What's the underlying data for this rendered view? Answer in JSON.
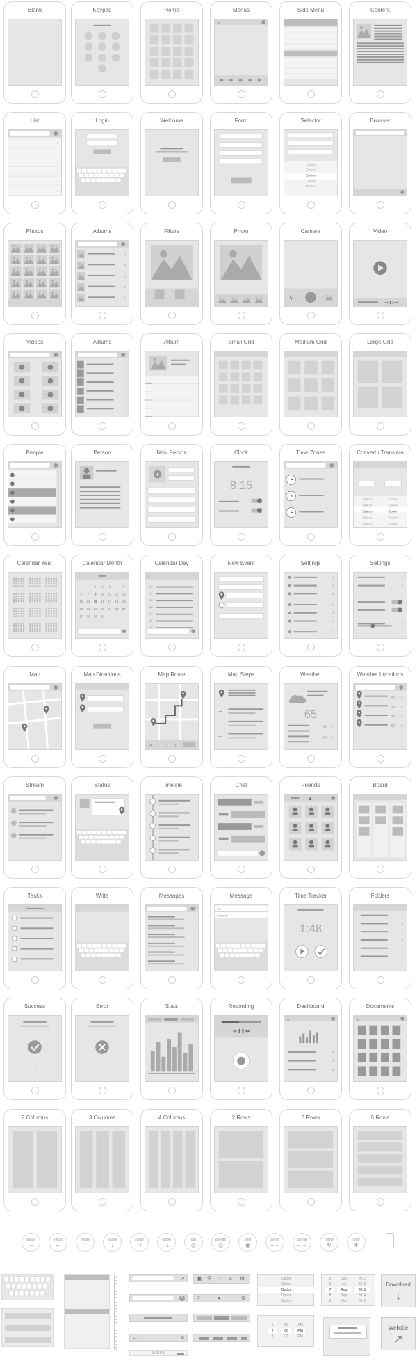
{
  "rows": [
    [
      "Blank",
      "Keypad",
      "Home",
      "Menus",
      "Side Menu",
      "Content"
    ],
    [
      "List",
      "Login",
      "Welcome",
      "Form",
      "Selector",
      "Browser"
    ],
    [
      "Photos",
      "Albums",
      "Filters",
      "Photo",
      "Camera",
      "Video"
    ],
    [
      "Videos",
      "Albums",
      "Album",
      "Small Grid",
      "Medium Grid",
      "Large Grid"
    ],
    [
      "People",
      "Person",
      "New Person",
      "Clock",
      "Time Zones",
      "Convert / Translate"
    ],
    [
      "Calendar Year",
      "Calendar Month",
      "Calendar Day",
      "New Event",
      "Settings",
      "Settings"
    ],
    [
      "Map",
      "Map Directions",
      "Map Route",
      "Map Steps",
      "Weather",
      "Weather Locations"
    ],
    [
      "Stream",
      "Status",
      "Timeline",
      "Chat",
      "Friends",
      "Board"
    ],
    [
      "Tasks",
      "Write",
      "Messages",
      "Message",
      "Time Tracker",
      "Folders"
    ],
    [
      "Success",
      "Error",
      "Stats",
      "Recording",
      "Dashboard",
      "Documents"
    ],
    [
      "2 Columns",
      "3 Columns",
      "4 Columns",
      "2 Rows",
      "3 Rows",
      "5 Rows"
    ]
  ],
  "screen_text": {
    "clock": "8:15",
    "weather_temp": "65",
    "time_tracker": "1:48",
    "weather_rows": [
      "68",
      "48",
      "64",
      "48"
    ],
    "weather_locations": [
      "84",
      "54",
      "38",
      "23",
      "75",
      "54",
      "65",
      "48"
    ],
    "selector_options": [
      "Option",
      "Option",
      "Option",
      "Option",
      "Option"
    ],
    "convert_options": [
      "Option",
      "Option",
      "Option",
      "Option",
      "Option",
      "Option",
      "Option",
      "Option",
      "Option",
      "Option"
    ],
    "message_to": "To:",
    "message_subject": "Subject:",
    "route_from": "A",
    "route_to": "B"
  },
  "calendar_month": {
    "days": [
      "1",
      "2",
      "3",
      "4",
      "5",
      "6",
      "7",
      "8",
      "9",
      "10",
      "11",
      "12",
      "13",
      "14",
      "15",
      "16",
      "17",
      "18",
      "19",
      "20",
      "21",
      "22",
      "23",
      "24",
      "25",
      "26",
      "27",
      "28",
      "29",
      "30"
    ]
  },
  "gestures": [
    {
      "label": "swipe",
      "icon": "→"
    },
    {
      "label": "swipe",
      "icon": "←"
    },
    {
      "label": "swipe",
      "icon": "↑"
    },
    {
      "label": "swipe",
      "icon": "↓"
    },
    {
      "label": "swipe",
      "icon": "↑↑"
    },
    {
      "label": "swipe",
      "icon": "↓↓"
    },
    {
      "label": "tap",
      "icon": "◎"
    },
    {
      "label": "dbl-tap",
      "icon": "◎"
    },
    {
      "label": "hold",
      "icon": "◉"
    },
    {
      "label": "pinch",
      "icon": "→←"
    },
    {
      "label": "spread",
      "icon": "←→"
    },
    {
      "label": "rotate",
      "icon": "↻"
    },
    {
      "label": "drag",
      "icon": "✥"
    }
  ],
  "components": {
    "picker_options": [
      "Option",
      "Option",
      "Option",
      "Option",
      "Option"
    ],
    "date_picker": {
      "days": [
        "5",
        "6",
        "7",
        "8",
        "9"
      ],
      "months": [
        "Jun",
        "Jul",
        "Aug",
        "Sep",
        "Oct"
      ],
      "years": [
        "2011",
        "2012",
        "2013",
        "2014",
        "2015"
      ]
    },
    "time_picker": {
      "hours": [
        "1",
        "2",
        "3"
      ],
      "minutes": [
        "59",
        "00",
        "01"
      ],
      "periods": [
        "AM",
        "PM",
        "PM"
      ]
    },
    "status_bar_time": "3:30 PM",
    "download_label": "Download",
    "website_label": "Website"
  }
}
